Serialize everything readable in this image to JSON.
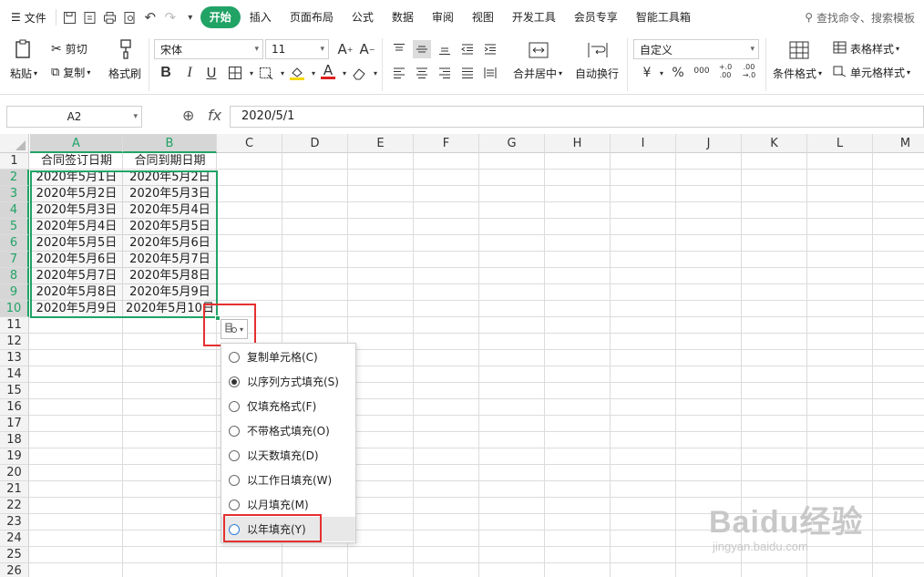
{
  "tabbar": {
    "menu_label": "文件",
    "tabs": [
      "开始",
      "插入",
      "页面布局",
      "公式",
      "数据",
      "审阅",
      "视图",
      "开发工具",
      "会员专享",
      "智能工具箱"
    ],
    "active_tab": "开始",
    "search_label": "查找命令、搜索模板"
  },
  "ribbon": {
    "paste": "粘贴",
    "cut": "剪切",
    "copy": "复制",
    "format_painter": "格式刷",
    "font_name": "宋体",
    "font_size": "11",
    "merge_center": "合并居中",
    "wrap_text": "自动换行",
    "number_format": "自定义",
    "table_style": "表格样式",
    "conditional_format": "条件格式",
    "cell_style": "单元格样式",
    "currency_symbol": "¥",
    "percent_symbol": "%",
    "thousands_symbol": "000",
    "increase_decimal": "+.0 .00",
    "decrease_decimal": ".00 →.0",
    "accent_color": "#21a366",
    "font_color": "#e02020",
    "fill_color": "#f5d800"
  },
  "formula_bar": {
    "name_box": "A2",
    "fx_label": "fx",
    "content": "2020/5/1"
  },
  "sheet": {
    "columns": [
      "A",
      "B",
      "C",
      "D",
      "E",
      "F",
      "G",
      "H",
      "I",
      "J",
      "K",
      "L",
      "M"
    ],
    "rows": [
      "1",
      "2",
      "3",
      "4",
      "5",
      "6",
      "7",
      "8",
      "9",
      "10",
      "11",
      "12",
      "13",
      "14",
      "15",
      "16",
      "17",
      "18",
      "19",
      "20",
      "21",
      "22",
      "23",
      "24",
      "25",
      "26"
    ],
    "header_row": [
      "合同签订日期",
      "合同到期日期"
    ],
    "data": [
      [
        "2020年5月1日",
        "2020年5月2日"
      ],
      [
        "2020年5月2日",
        "2020年5月3日"
      ],
      [
        "2020年5月3日",
        "2020年5月4日"
      ],
      [
        "2020年5月4日",
        "2020年5月5日"
      ],
      [
        "2020年5月5日",
        "2020年5月6日"
      ],
      [
        "2020年5月6日",
        "2020年5月7日"
      ],
      [
        "2020年5月7日",
        "2020年5月8日"
      ],
      [
        "2020年5月8日",
        "2020年5月9日"
      ],
      [
        "2020年5月9日",
        "2020年5月10日"
      ]
    ]
  },
  "autofill_menu": {
    "options": [
      "复制单元格(C)",
      "以序列方式填充(S)",
      "仅填充格式(F)",
      "不带格式填充(O)",
      "以天数填充(D)",
      "以工作日填充(W)",
      "以月填充(M)",
      "以年填充(Y)"
    ],
    "selected": "以序列方式填充(S)",
    "highlighted": "以年填充(Y)"
  },
  "watermark": {
    "brand": "Baidu经验",
    "url": "jingyan.baidu.com"
  },
  "colors": {
    "accent": "#21a366",
    "annotation_red": "#e53030"
  }
}
